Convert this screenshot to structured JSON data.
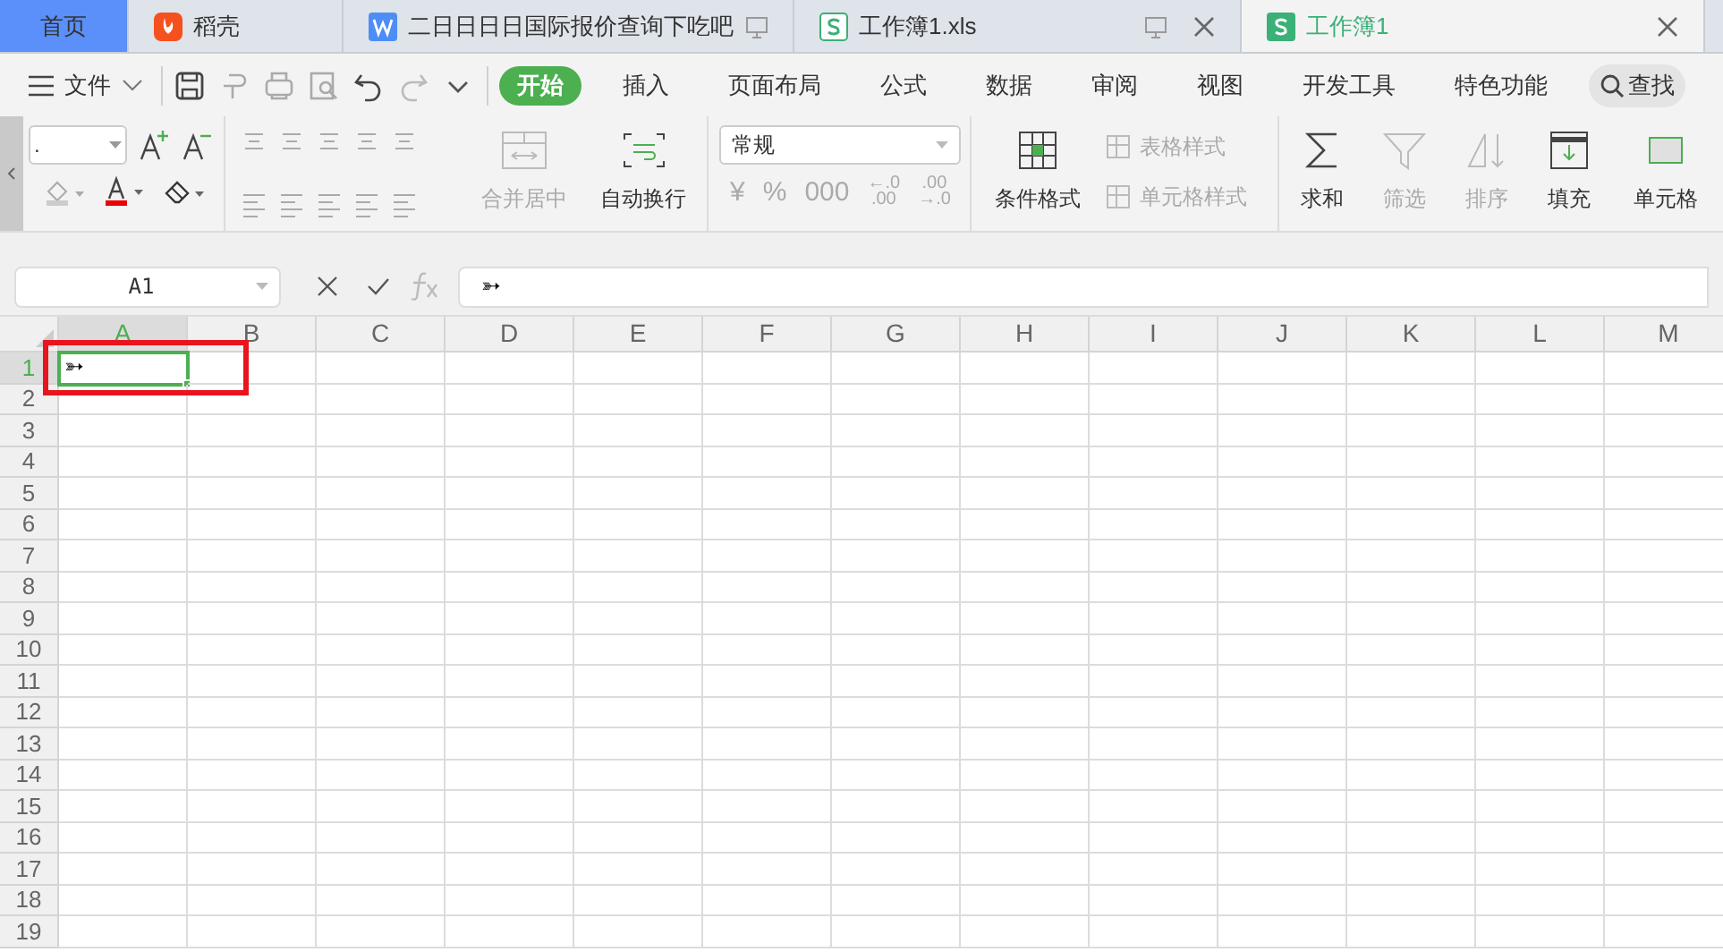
{
  "tabs": [
    {
      "kind": "home",
      "label": "首页",
      "selected": false
    },
    {
      "kind": "app",
      "label": "稻壳",
      "selected": false
    },
    {
      "kind": "doc",
      "label": "二日日日日国际报价查询下吃吧",
      "selected": false
    },
    {
      "kind": "sheet",
      "label": "工作簿1.xls",
      "selected": false
    },
    {
      "kind": "sheet",
      "label": "工作簿1",
      "selected": true
    }
  ],
  "menu": {
    "file": "文件",
    "tabs": [
      {
        "label": "开始",
        "selected": true
      },
      {
        "label": "插入",
        "selected": false
      },
      {
        "label": "页面布局",
        "selected": false
      },
      {
        "label": "公式",
        "selected": false
      },
      {
        "label": "数据",
        "selected": false
      },
      {
        "label": "审阅",
        "selected": false
      },
      {
        "label": "视图",
        "selected": false
      },
      {
        "label": "开发工具",
        "selected": false
      },
      {
        "label": "特色功能",
        "selected": false
      }
    ],
    "search": "查找"
  },
  "ribbon": {
    "font_field": ".",
    "merge": {
      "label": "合并居中",
      "disabled": true
    },
    "wrap": {
      "label": "自动换行",
      "disabled": false
    },
    "number_format": "常规",
    "number_buttons": [
      {
        "lines": [
          "¥"
        ],
        "disabled": true
      },
      {
        "lines": [
          "%"
        ],
        "disabled": true
      },
      {
        "lines": [
          "000"
        ],
        "disabled": true
      },
      {
        "lines": [
          "←.0",
          ".00"
        ],
        "disabled": true
      },
      {
        "lines": [
          ".00",
          "→.0"
        ],
        "disabled": true
      }
    ],
    "conditional": {
      "label": "条件格式",
      "disabled": false
    },
    "styles": [
      {
        "label": "表格样式",
        "disabled": true
      },
      {
        "label": "单元格样式",
        "disabled": true
      }
    ],
    "tools": [
      {
        "label": "求和",
        "disabled": false
      },
      {
        "label": "筛选",
        "disabled": true
      },
      {
        "label": "排序",
        "disabled": true
      },
      {
        "label": "填充",
        "disabled": false
      },
      {
        "label": "单元格",
        "disabled": false
      }
    ]
  },
  "formula_bar": {
    "name_box": "A1",
    "value": "➳"
  },
  "sheet": {
    "columns": [
      "A",
      "B",
      "C",
      "D",
      "E",
      "F",
      "G",
      "H",
      "I",
      "J",
      "K",
      "L",
      "M"
    ],
    "rows": [
      "1",
      "2",
      "3",
      "4",
      "5",
      "6",
      "7",
      "8",
      "9",
      "10",
      "11",
      "12",
      "13",
      "14",
      "15",
      "16",
      "17",
      "18",
      "19"
    ],
    "grid": [
      [
        {
          "text": "➳",
          "selected": true
        }
      ]
    ],
    "highlight_frame": true
  }
}
